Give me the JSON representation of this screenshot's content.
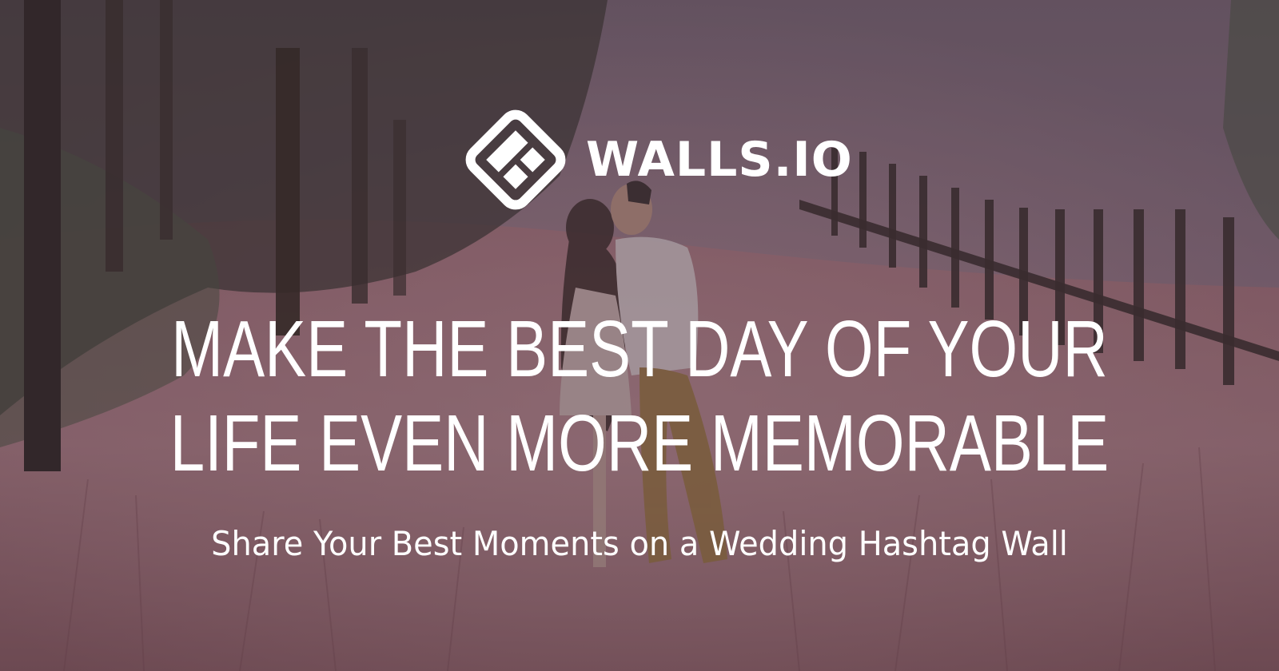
{
  "brand": {
    "name": "WALLS.IO",
    "logo_icon": "walls-io-diamond-logo-icon",
    "text_color": "#ffffff"
  },
  "hero": {
    "headline_line1": "MAKE THE BEST DAY OF YOUR",
    "headline_line2": "LIFE EVEN MORE MEMORABLE",
    "subtitle": "Share Your Best Moments on a Wedding Hashtag Wall",
    "background": "photo-couple-kissing-in-grass-field",
    "overlay_color": "#3a2a37"
  }
}
